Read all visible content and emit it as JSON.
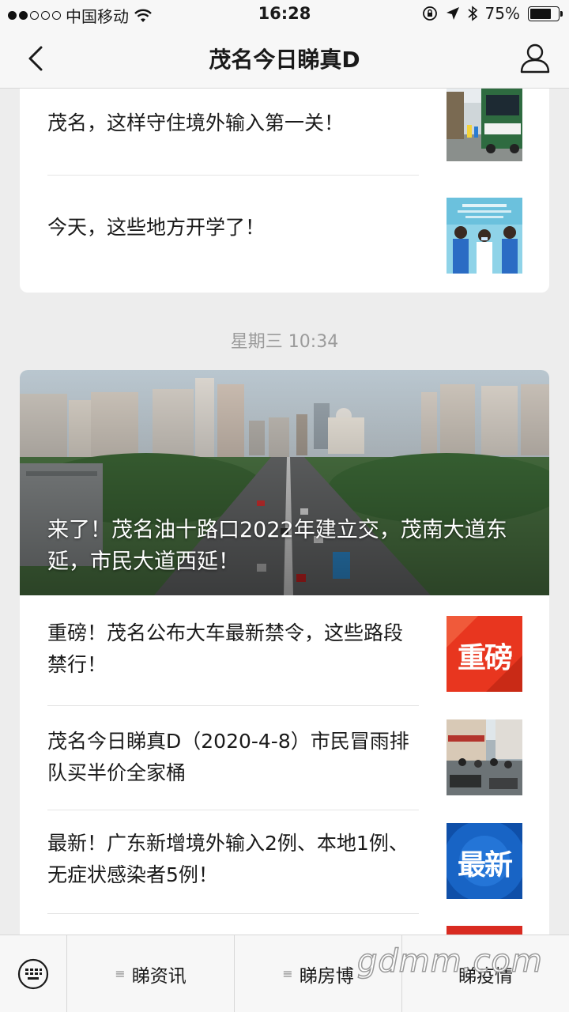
{
  "status_bar": {
    "carrier": "中国移动",
    "time": "16:28",
    "battery_percent": "75%",
    "battery_level": 0.75,
    "signal_filled": 2,
    "signal_total": 5
  },
  "nav": {
    "title": "茂名今日睇真D"
  },
  "feed": {
    "card1": {
      "rows": [
        {
          "title": "茂名，这样守住境外输入第一关！",
          "thumb_icon": "bus-street-photo"
        },
        {
          "title": "今天，这些地方开学了！",
          "thumb_icon": "students-masks-photo"
        }
      ]
    },
    "timestamp": "星期三 10:34",
    "card2": {
      "hero_title": "来了！茂名油十路口2022年建立交，茂南大道东延，市民大道西延！",
      "rows": [
        {
          "title": "重磅！茂名公布大车最新禁令，这些路段禁行！",
          "thumb_text": "重磅",
          "thumb_color": "#e8361f"
        },
        {
          "title": "茂名今日睇真D（2020-4-8）市民冒雨排队买半价全家桶",
          "thumb_icon": "rainy-street-photo"
        },
        {
          "title": "最新！广东新增境外输入2例、本地1例、无症状感染者5例！",
          "thumb_text": "最新",
          "thumb_color": "#1565c0"
        }
      ]
    }
  },
  "menu": {
    "items": [
      {
        "label": "睇资讯"
      },
      {
        "label": "睇房博"
      },
      {
        "label": "睇疫情"
      }
    ]
  },
  "watermark": "gdmm.com"
}
